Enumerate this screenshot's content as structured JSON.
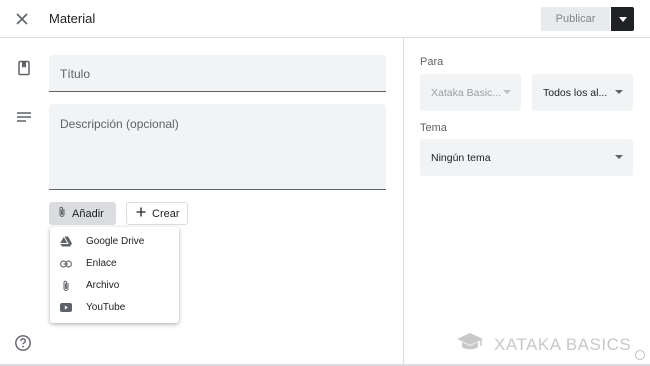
{
  "header": {
    "title": "Material",
    "publish_label": "Publicar"
  },
  "form": {
    "title_placeholder": "Título",
    "description_placeholder": "Descripción (opcional)",
    "add_label": "Añadir",
    "create_label": "Crear"
  },
  "add_menu": {
    "items": [
      {
        "label": "Google Drive",
        "icon": "google-drive-icon"
      },
      {
        "label": "Enlace",
        "icon": "link-icon"
      },
      {
        "label": "Archivo",
        "icon": "attachment-icon"
      },
      {
        "label": "YouTube",
        "icon": "youtube-icon"
      }
    ]
  },
  "sidebar": {
    "for_label": "Para",
    "class_value": "Xataka Basic...",
    "students_value": "Todos los al...",
    "topic_label": "Tema",
    "topic_value": "Ningún tema"
  },
  "watermark": {
    "text": "XATAKA BASICS"
  },
  "colors": {
    "accent_dark": "#202124",
    "field_bg": "#f1f3f4",
    "border": "#dadce0",
    "muted_text": "#5f6368"
  }
}
